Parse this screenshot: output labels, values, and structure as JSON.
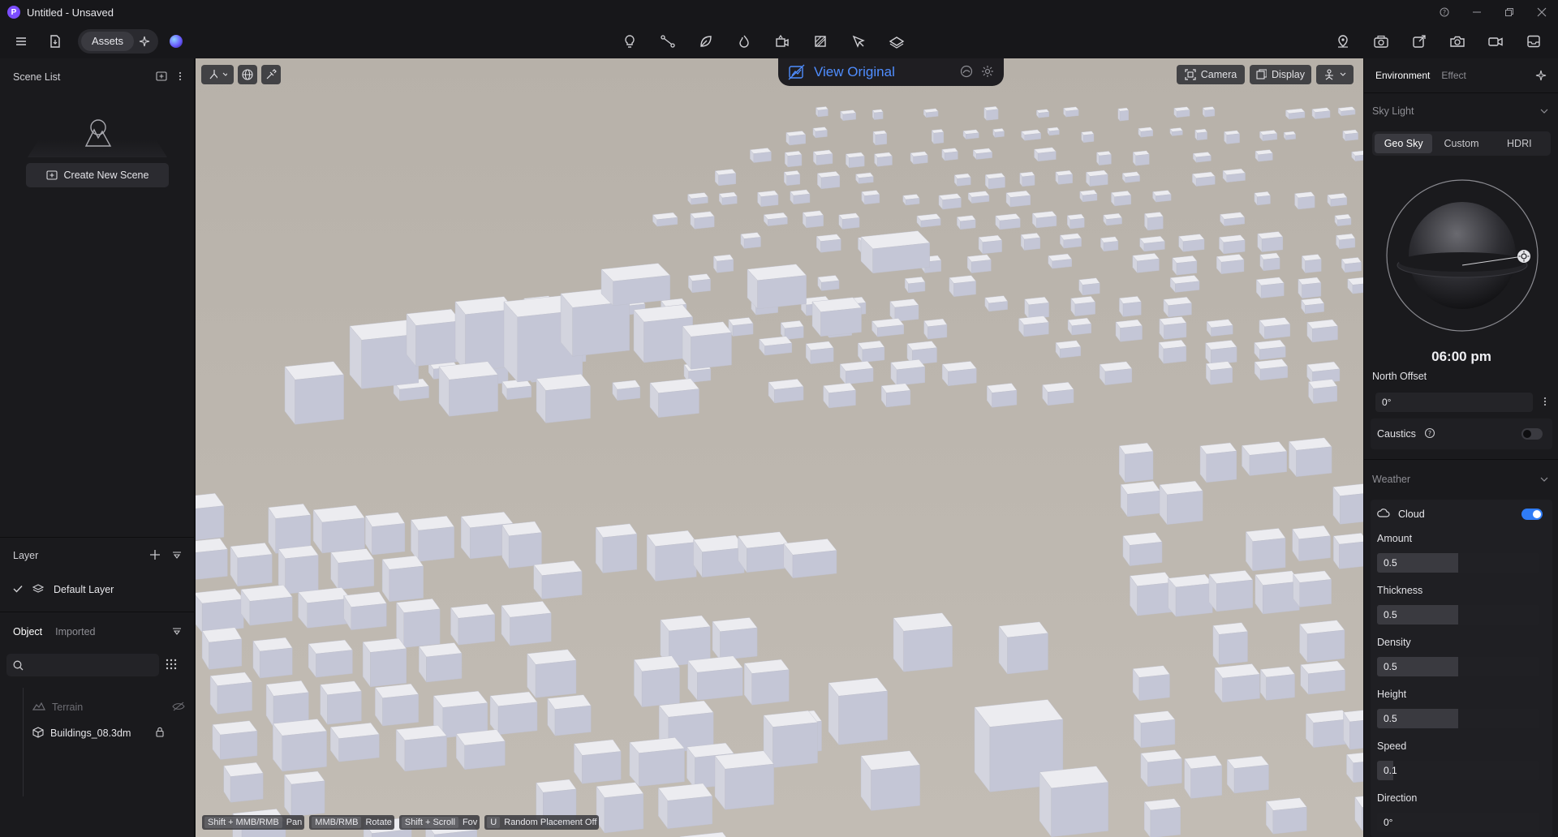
{
  "window": {
    "title": "Untitled - Unsaved",
    "logo_letter": "P"
  },
  "toolbar": {
    "assets_label": "Assets"
  },
  "scene_list": {
    "title": "Scene List",
    "create_button": "Create New Scene"
  },
  "layers": {
    "title": "Layer",
    "items": [
      {
        "label": "Default Layer",
        "checked": true
      }
    ]
  },
  "objects": {
    "tabs": [
      {
        "label": "Object",
        "active": true
      },
      {
        "label": "Imported",
        "active": false
      }
    ],
    "search_placeholder": "",
    "items": [
      {
        "label": "Terrain",
        "icon": "terrain-icon",
        "hidden": true
      },
      {
        "label": "Buildings_08.3dm",
        "icon": "cube-icon",
        "locked": true
      }
    ]
  },
  "viewport": {
    "view_original_label": "View Original",
    "camera_label": "Camera",
    "display_label": "Display",
    "shortcuts": [
      {
        "key": "Shift + MMB/RMB",
        "action": "Pan"
      },
      {
        "key": "MMB/RMB",
        "action": "Rotate"
      },
      {
        "key": "Shift + Scroll",
        "action": "Fov"
      },
      {
        "key": "U",
        "action": "Random Placement Off"
      }
    ]
  },
  "environment": {
    "tabs": [
      {
        "label": "Environment",
        "active": true
      },
      {
        "label": "Effect",
        "active": false
      }
    ],
    "sky_light": {
      "title": "Sky Light",
      "modes": [
        {
          "label": "Geo Sky",
          "active": true
        },
        {
          "label": "Custom",
          "active": false
        },
        {
          "label": "HDRI",
          "active": false
        }
      ],
      "time": "06:00 pm",
      "north_offset_label": "North Offset",
      "north_offset_value": "0°",
      "caustics_label": "Caustics",
      "caustics_on": false
    },
    "weather": {
      "title": "Weather",
      "cloud_label": "Cloud",
      "cloud_on": true,
      "params": [
        {
          "label": "Amount",
          "value": "0.5",
          "fraction": 0.5
        },
        {
          "label": "Thickness",
          "value": "0.5",
          "fraction": 0.5
        },
        {
          "label": "Density",
          "value": "0.5",
          "fraction": 0.5
        },
        {
          "label": "Height",
          "value": "0.5",
          "fraction": 0.5
        },
        {
          "label": "Speed",
          "value": "0.1",
          "fraction": 0.1
        },
        {
          "label": "Direction",
          "value": "0°",
          "fraction": 0
        }
      ]
    }
  },
  "colors": {
    "accent": "#2f7cf6",
    "view_original_text": "#4f8dff",
    "panel_bg": "#1a1a1d",
    "viewport_ground": "#bdb6ae",
    "building": "#e9e9ee"
  }
}
